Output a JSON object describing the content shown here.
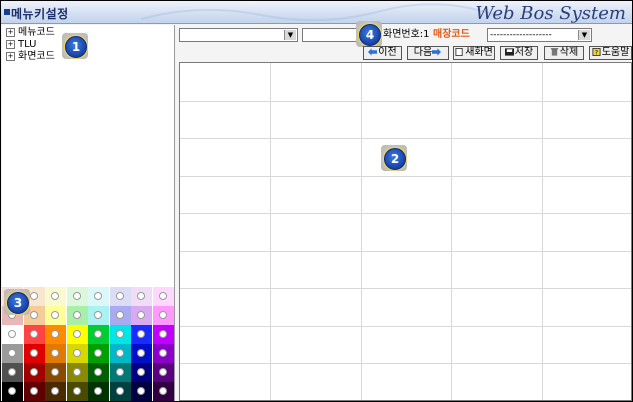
{
  "window": {
    "title": "메뉴키설정",
    "brand": "Web Bos System"
  },
  "tree": {
    "items": [
      {
        "label": "메뉴코드",
        "expander": "+"
      },
      {
        "label": "TLU",
        "expander": "+"
      },
      {
        "label": "화면코드",
        "expander": "+"
      }
    ]
  },
  "markers": {
    "m1": "1",
    "m2": "2",
    "m3": "3",
    "m4": "4"
  },
  "toolbar": {
    "select1_value": "",
    "select2_value": "",
    "screen_no_label": "화면번호:1",
    "store_code_label": "매장코드",
    "store_select_value": "-------------------",
    "buttons": {
      "prev": "이전",
      "next": "다음",
      "new": "새화면",
      "save": "저장",
      "delete": "삭제",
      "help": "도움말"
    }
  },
  "palette": {
    "colors": [
      [
        "#f7dede",
        "#f7e7cf",
        "#fafad0",
        "#dcf7dc",
        "#dcf7f7",
        "#dcdcf7",
        "#f0dcf7",
        "#ffd8ff"
      ],
      [
        "#e8b8b8",
        "#f5cc99",
        "#ffff99",
        "#a8f0a8",
        "#aaf2f2",
        "#aaaaf0",
        "#d8aaf0",
        "#ff99ff"
      ],
      [
        "#ffffff",
        "#ff4444",
        "#ff8a00",
        "#ffff00",
        "#00cc33",
        "#00e5e5",
        "#1a2bff",
        "#c000ff"
      ],
      [
        "#9a9a9a",
        "#e00000",
        "#e07a00",
        "#d8d800",
        "#00a000",
        "#00b8c8",
        "#0010c8",
        "#8a00c8"
      ],
      [
        "#505050",
        "#a00000",
        "#8a4a00",
        "#8a8a00",
        "#006000",
        "#007878",
        "#000080",
        "#5a0080"
      ],
      [
        "#000000",
        "#600000",
        "#4a2a00",
        "#4a4a00",
        "#003300",
        "#004040",
        "#000040",
        "#300040"
      ]
    ]
  }
}
